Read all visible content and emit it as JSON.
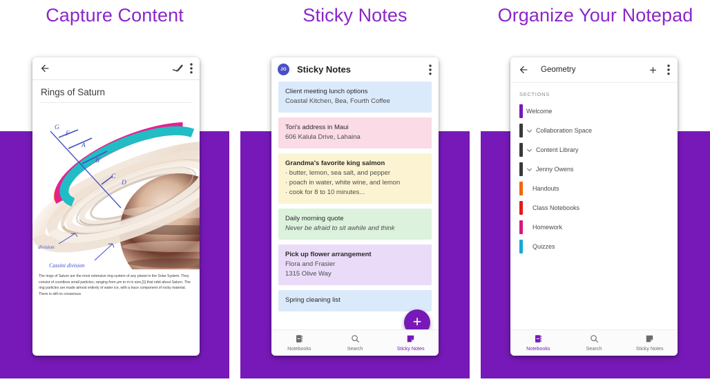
{
  "colors": {
    "brand_purple": "#7719b8",
    "heading_purple": "#8b27c9",
    "avatar_blue": "#4a50c4",
    "note_blue": "#dbeafb",
    "note_pink": "#fadbe6",
    "note_yellow": "#fcf3d2",
    "note_green": "#dcf2dd",
    "note_lavender": "#eadcf8"
  },
  "headings": {
    "panel1": "Capture Content",
    "panel2": "Sticky Notes",
    "panel3": "Organize Your Notepad"
  },
  "panel1": {
    "topbar": {
      "back_icon": "arrow-left-icon",
      "ink_icon": "ink-pen-icon",
      "overflow_icon": "more-vertical-icon"
    },
    "note_title": "Rings of Saturn",
    "image": {
      "name": "saturn-rings-illustration",
      "ring_labels": [
        "G",
        "F",
        "A",
        "B",
        "C",
        "D"
      ],
      "annotations": [
        "division",
        "Cassini division"
      ]
    },
    "paragraph": "The rings of Saturn are the most extensive ring system of any planet in the Solar System. They consist of countless small particles, ranging from μm to m in size,[1] that orbit about Saturn. The ring particles are made almost entirely of water ice, with a trace component of rocky material. There is still no consensus"
  },
  "panel2": {
    "topbar": {
      "avatar_initials": "JO",
      "title": "Sticky Notes",
      "overflow_icon": "more-vertical-icon"
    },
    "notes": [
      {
        "color": "#dbeafb",
        "title": "Client meeting lunch options",
        "title_bold": false,
        "lines": [
          "Coastal Kitchen, Bea, Fourth Coffee"
        ],
        "italic": false
      },
      {
        "color": "#fadbe6",
        "title": "Tori's address in Maui",
        "title_bold": false,
        "lines": [
          "606 Kalula Drive, Lahaina"
        ],
        "italic": false
      },
      {
        "color": "#fcf3d2",
        "title": "Grandma's favorite king salmon",
        "title_bold": true,
        "lines": [
          "· butter, lemon, sea salt, and pepper",
          "· poach in water, white wine, and lemon",
          "· cook for 8 to 10 minutes..."
        ],
        "italic": false
      },
      {
        "color": "#dcf2dd",
        "title": "Daily morning quote",
        "title_bold": false,
        "lines": [
          "Never be afraid to sit awhile and think"
        ],
        "italic": true
      },
      {
        "color": "#eadcf8",
        "title": "Pick up flower arrangement",
        "title_bold": true,
        "lines": [
          "Flora and Frasier",
          "1315 Olive Way"
        ],
        "italic": false
      },
      {
        "color": "#dbeafb",
        "title": "Spring cleaning list",
        "title_bold": false,
        "lines": [],
        "italic": false
      }
    ],
    "fab": {
      "icon": "plus-icon",
      "label": "+"
    },
    "bottomnav": [
      {
        "icon": "notebook-icon",
        "label": "Notebooks",
        "active": false
      },
      {
        "icon": "search-icon",
        "label": "Search",
        "active": false
      },
      {
        "icon": "sticky-note-icon",
        "label": "Sticky Notes",
        "active": true
      }
    ]
  },
  "panel3": {
    "topbar": {
      "back_icon": "arrow-left-icon",
      "title": "Geometry",
      "add_icon": "plus-icon",
      "overflow_icon": "more-vertical-icon"
    },
    "sections_label": "SECTIONS",
    "sections": [
      {
        "label": "Welcome",
        "color": "#7719b8",
        "expandable": false,
        "child": false
      },
      {
        "label": "Collaboration Space",
        "color": "#3b3a39",
        "expandable": true,
        "child": false
      },
      {
        "label": "Content Library",
        "color": "#3b3a39",
        "expandable": true,
        "child": false
      },
      {
        "label": "Jenny Owens",
        "color": "#3b3a39",
        "expandable": true,
        "child": false
      },
      {
        "label": "Handouts",
        "color": "#f2670a",
        "expandable": false,
        "child": true
      },
      {
        "label": "Class Notebooks",
        "color": "#e21b1b",
        "expandable": false,
        "child": true
      },
      {
        "label": "Homework",
        "color": "#d6197f",
        "expandable": false,
        "child": true
      },
      {
        "label": "Quizzes",
        "color": "#16a9d9",
        "expandable": false,
        "child": true
      }
    ],
    "bottomnav": [
      {
        "icon": "notebook-icon",
        "label": "Notebooks",
        "active": true
      },
      {
        "icon": "search-icon",
        "label": "Search",
        "active": false
      },
      {
        "icon": "sticky-note-icon",
        "label": "Sticky Notes",
        "active": false
      }
    ]
  }
}
